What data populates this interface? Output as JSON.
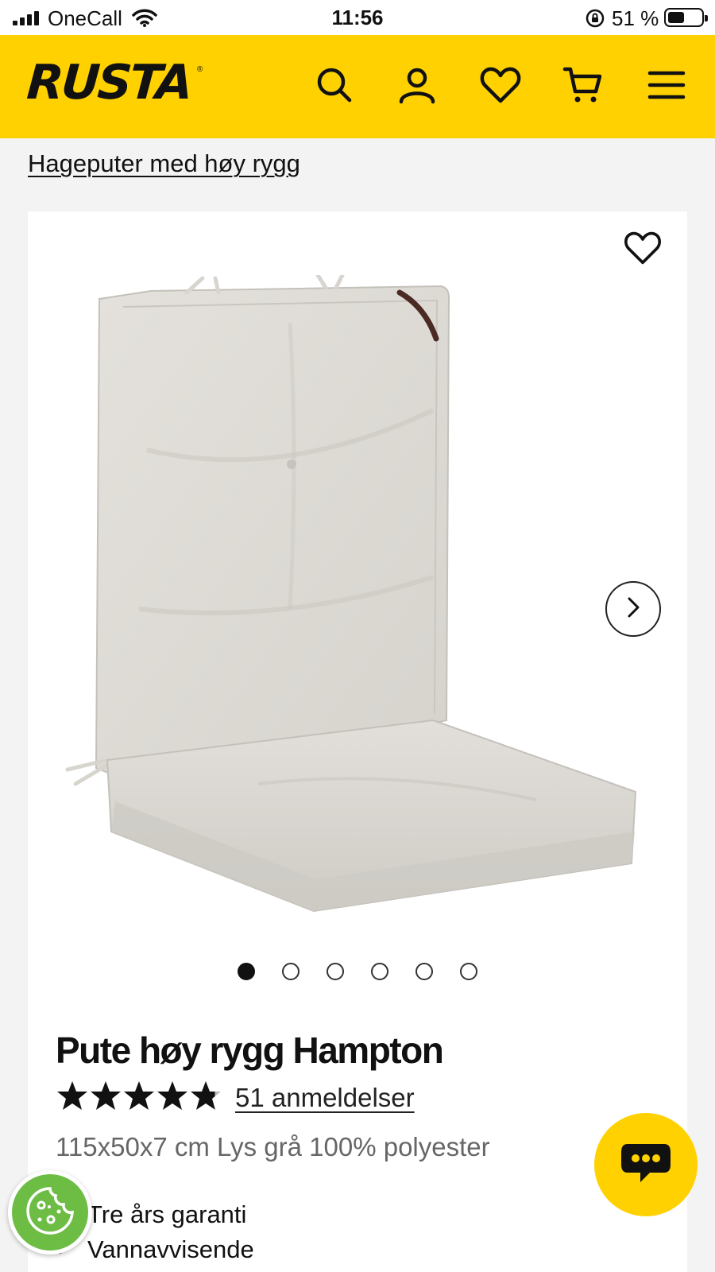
{
  "status_bar": {
    "carrier": "OneCall",
    "time": "11:56",
    "battery_percent": "51 %",
    "battery_level": 0.51
  },
  "header": {
    "logo_text": "RUSTA",
    "logo_mark": "®",
    "icons": [
      "search-icon",
      "account-icon",
      "heart-icon",
      "cart-icon",
      "menu-icon"
    ],
    "background_color": "#ffd100"
  },
  "breadcrumb": {
    "label": "Hageputer med høy rygg"
  },
  "product": {
    "title": "Pute høy rygg Hampton",
    "rating": 4.8,
    "rating_max": 5,
    "reviews_link": "51 anmeldelser",
    "description": "115x50x7 cm Lys grå 100% polyester",
    "usps": [
      "Tre års garanti",
      "Vannavvisende"
    ],
    "gallery": {
      "image_count": 6,
      "active_index": 0
    }
  },
  "floating": {
    "chat_icon": "chat-bubble-icon",
    "cookie_icon": "cookie-icon",
    "chat_color": "#ffd100",
    "cookie_color": "#6dbd45"
  }
}
